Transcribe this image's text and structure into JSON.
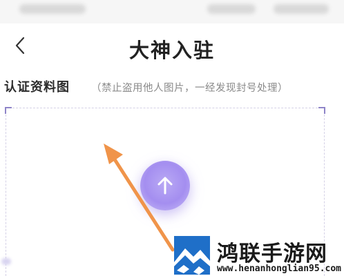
{
  "header": {
    "title": "大神入驻"
  },
  "section": {
    "label": "认证资料图",
    "hint": "（禁止盗用他人图片，一经发现封号处理）"
  },
  "watermark": {
    "title": "鸿联手游网",
    "url": "www.henanhonglian95.com"
  },
  "colors": {
    "accent": "#a48ef0",
    "annotation_arrow": "#f0944a",
    "logo_blue": "#1f6fc8"
  },
  "icons": {
    "back": "chevron-left-icon",
    "upload": "arrow-up-icon",
    "annotation": "pointer-arrow-icon"
  }
}
